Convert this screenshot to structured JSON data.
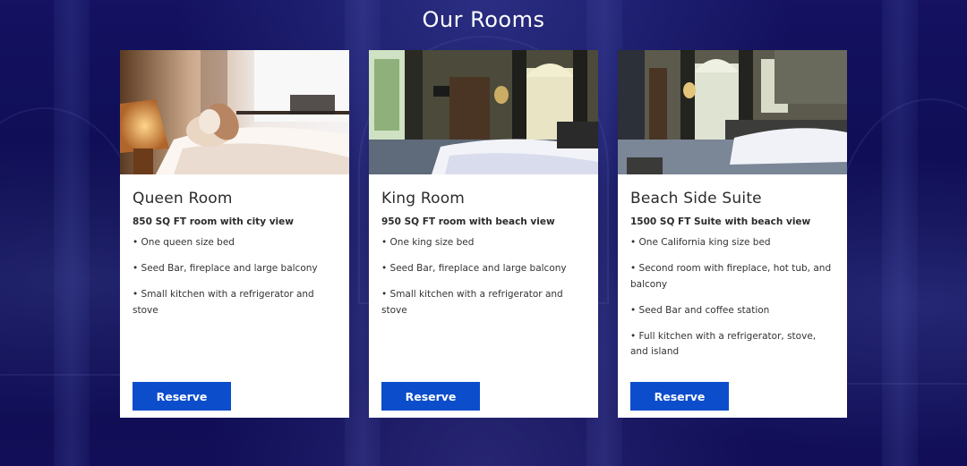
{
  "page": {
    "title": "Our Rooms"
  },
  "rooms": [
    {
      "name": "Queen Room",
      "subtitle": "850 SQ FT room with city view",
      "features": [
        "• One queen size bed",
        "• Seed Bar, fireplace and large balcony",
        "• Small kitchen with a refrigerator and stove"
      ],
      "button_label": "Reserve",
      "image": "queen-room-photo"
    },
    {
      "name": "King Room",
      "subtitle": "950 SQ FT room with beach view",
      "features": [
        "• One king size bed",
        "• Seed Bar, fireplace and large balcony",
        "• Small kitchen with a refrigerator and stove"
      ],
      "button_label": "Reserve",
      "image": "king-room-photo"
    },
    {
      "name": "Beach Side Suite",
      "subtitle": "1500 SQ FT Suite with beach view",
      "features": [
        "• One California king size bed",
        "• Second room with fireplace, hot tub, and balcony",
        "• Seed Bar and coffee station",
        "• Full kitchen with a refrigerator, stove, and island"
      ],
      "button_label": "Reserve",
      "image": "beach-suite-photo"
    }
  ],
  "colors": {
    "background": "#0c0b4a",
    "card": "#ffffff",
    "button": "#0c4dcc",
    "heading": "#ffffff",
    "text": "#2b2b2b"
  }
}
